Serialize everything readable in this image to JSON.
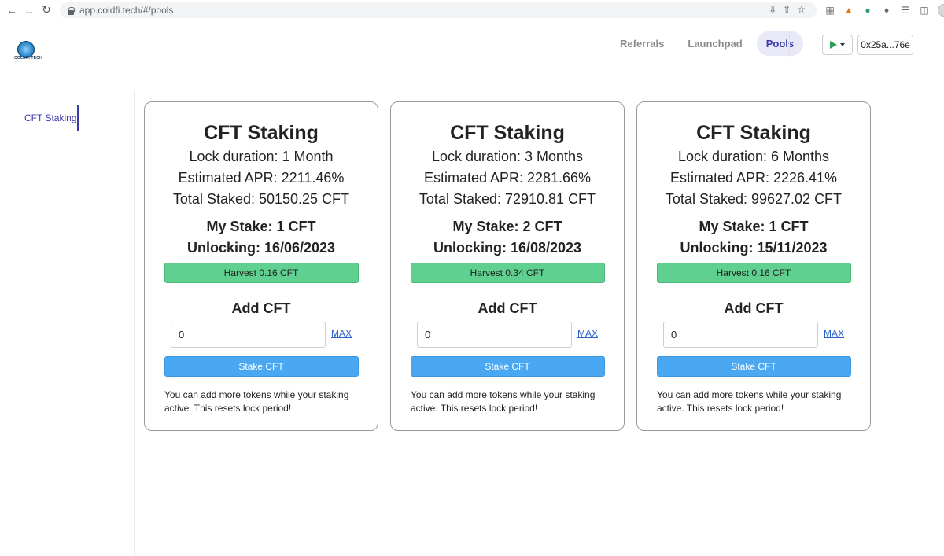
{
  "browser": {
    "url": "app.coldfi.tech/#/pools"
  },
  "header": {
    "logo_text": "COLDFI TECH",
    "nav": [
      {
        "label": "Referrals",
        "active": false
      },
      {
        "label": "Launchpad",
        "active": false
      },
      {
        "label": "Pools",
        "active": true
      }
    ],
    "wallet_address": "0x25a...76e"
  },
  "sidebar": {
    "items": [
      {
        "label": "CFT Staking",
        "active": true
      }
    ]
  },
  "pools": [
    {
      "title": "CFT Staking",
      "lock_duration": "Lock duration: 1 Month",
      "apr": "Estimated APR: 2211.46%",
      "total_staked": "Total Staked: 50150.25 CFT",
      "my_stake": "My Stake: 1 CFT",
      "unlocking": "Unlocking: 16/06/2023",
      "harvest_label": "Harvest 0.16 CFT",
      "add_title": "Add CFT",
      "input_value": "0",
      "max_label": "MAX",
      "stake_label": "Stake CFT",
      "note": "You can add more tokens while your staking active. This resets lock period!"
    },
    {
      "title": "CFT Staking",
      "lock_duration": "Lock duration: 3 Months",
      "apr": "Estimated APR: 2281.66%",
      "total_staked": "Total Staked: 72910.81 CFT",
      "my_stake": "My Stake: 2 CFT",
      "unlocking": "Unlocking: 16/08/2023",
      "harvest_label": "Harvest 0.34 CFT",
      "add_title": "Add CFT",
      "input_value": "0",
      "max_label": "MAX",
      "stake_label": "Stake CFT",
      "note": "You can add more tokens while your staking active. This resets lock period!"
    },
    {
      "title": "CFT Staking",
      "lock_duration": "Lock duration: 6 Months",
      "apr": "Estimated APR: 2226.41%",
      "total_staked": "Total Staked: 99627.02 CFT",
      "my_stake": "My Stake: 1 CFT",
      "unlocking": "Unlocking: 15/11/2023",
      "harvest_label": "Harvest 0.16 CFT",
      "add_title": "Add CFT",
      "input_value": "0",
      "max_label": "MAX",
      "stake_label": "Stake CFT",
      "note": "You can add more tokens while your staking active. This resets lock period!"
    }
  ],
  "colors": {
    "accent": "#3a3ab0",
    "harvest": "#5fd08f",
    "stake": "#4aa8f2",
    "link": "#2a62c9"
  }
}
